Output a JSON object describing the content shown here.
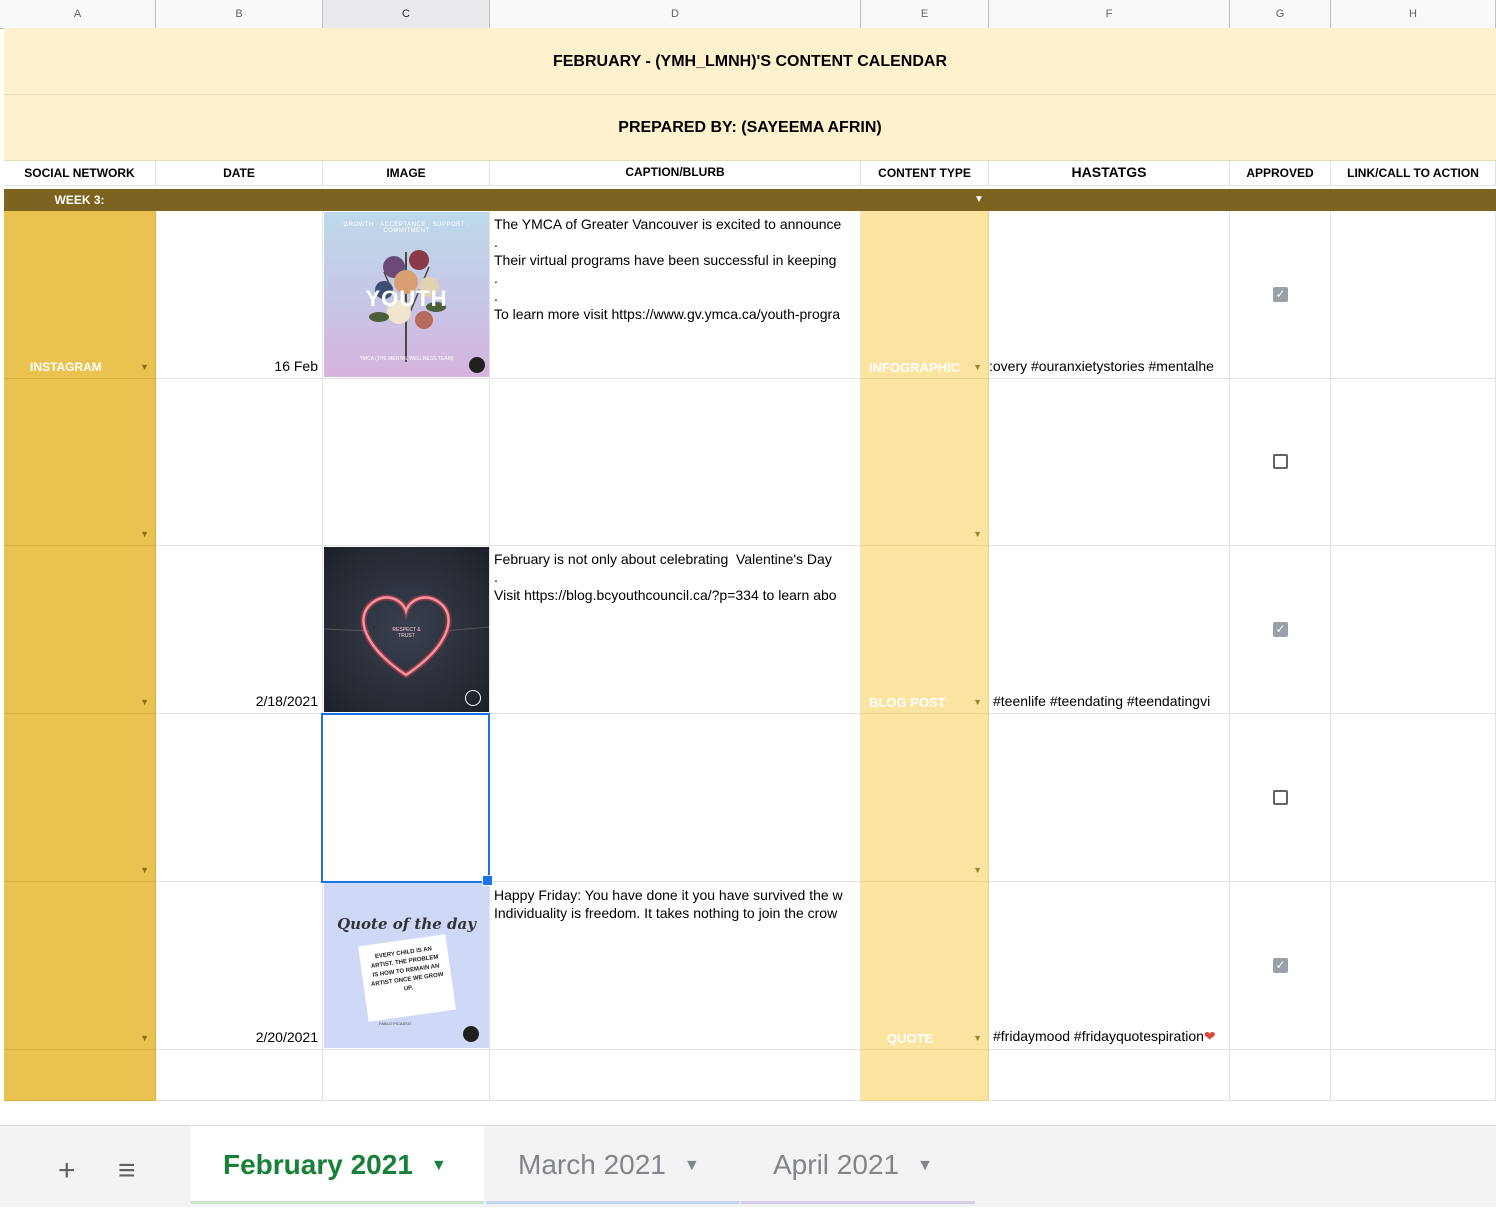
{
  "columns": [
    "A",
    "B",
    "C",
    "D",
    "E",
    "F",
    "G",
    "H"
  ],
  "title": "FEBRUARY - (YMH_LMNH)'S CONTENT CALENDAR",
  "prepared_by": "PREPARED BY: (SAYEEMA AFRIN)",
  "headers": {
    "social_network": "SOCIAL NETWORK",
    "date": "DATE",
    "image": "IMAGE",
    "caption": "CAPTION/BLURB",
    "content_type": "CONTENT TYPE",
    "hashtags": "HASTATGS",
    "approved": "APPROVED",
    "link": "LINK/CALL TO ACTION"
  },
  "week_label": "WEEK 3:",
  "rows": [
    {
      "network": "INSTAGRAM",
      "date": "16 Feb",
      "caption": "The YMCA of Greater Vancouver is excited to announce\n.\nTheir virtual programs have been successful in keeping\n.\n.\nTo learn more visit https://www.gv.ymca.ca/youth-progra",
      "content_type": "INFOGRAPHIC",
      "hashtags": ":overy #ouranxietystories #mentalhe",
      "approved": true,
      "image": {
        "kind": "youth",
        "top_text": "GROWTH · ACCEPTANCE · SUPPORT · COMMITMENT",
        "headline": "YOUTH",
        "footer": "YMCA (THE MENTAL WELLNESS TEAM)"
      }
    },
    {
      "network": "",
      "date": "",
      "caption": "",
      "content_type": "",
      "hashtags": "",
      "approved": false,
      "image": null
    },
    {
      "network": "",
      "date": "2/18/2021",
      "caption": "February is not only about celebrating  Valentine's Day\n.\nVisit https://blog.bcyouthcouncil.ca/?p=334 to learn abo",
      "content_type": "BLOG POST",
      "hashtags": "#teenlife #teendating #teendatingvi",
      "approved": true,
      "image": {
        "kind": "heart",
        "center_text": "RESPECT & TRUST"
      }
    },
    {
      "network": "",
      "date": "",
      "caption": "",
      "content_type": "",
      "hashtags": "",
      "approved": false,
      "image": null
    },
    {
      "network": "",
      "date": "2/20/2021",
      "caption": "Happy Friday: You have done it you have survived the w\nIndividuality is freedom. It takes nothing to join the crow",
      "content_type": "QUOTE",
      "hashtags": "#fridaymood #fridayquotespiration",
      "approved": true,
      "image": {
        "kind": "quote",
        "title": "Quote of the day",
        "quote": "EVERY CHILD IS AN ARTIST. THE PROBLEM IS HOW TO REMAIN AN ARTIST ONCE WE GROW UP.",
        "author": "PABLO PICASSO"
      }
    }
  ],
  "tabs": [
    {
      "label": "February 2021",
      "active": true
    },
    {
      "label": "March 2021",
      "active": false
    },
    {
      "label": "April 2021",
      "active": false
    }
  ],
  "icons": {
    "add": "plus-icon",
    "list": "list-icon"
  },
  "colors": {
    "network_col": "#eac24f",
    "content_col": "#fbe4a0",
    "banner": "#fdf2cd",
    "week_bar": "#7c6320",
    "active_tab": "#188038",
    "selection": "#1a73e8"
  }
}
